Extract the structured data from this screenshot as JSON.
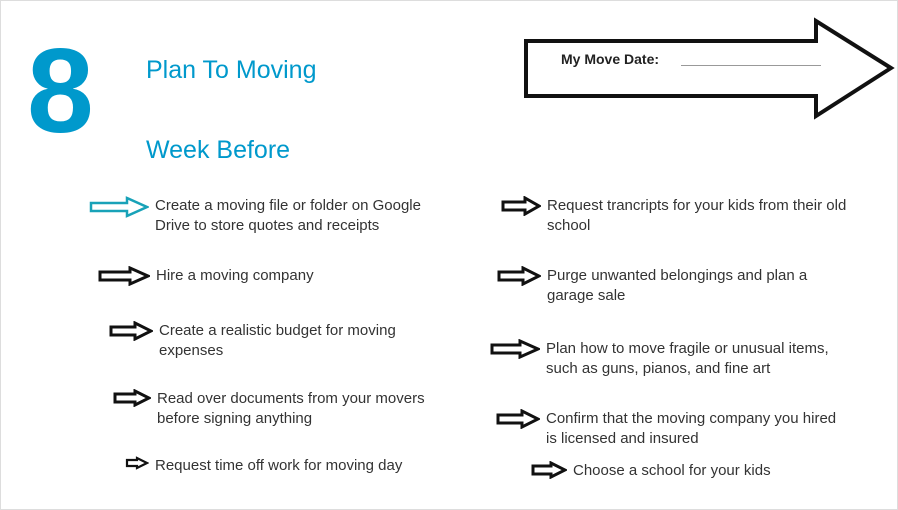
{
  "header": {
    "number": "8",
    "title_line1": "Plan To Moving",
    "title_line2": "Week Before",
    "move_date_label": "My Move Date:"
  },
  "left_items": [
    "Create a moving file or folder on Google Drive to store quotes and receipts",
    "Hire a moving company",
    "Create a realistic budget for moving expenses",
    "Read over documents from your movers before signing anything",
    "Request time off work for moving day"
  ],
  "right_items": [
    "Request trancripts for your kids from their old school",
    "Purge unwanted belongings and plan a garage sale",
    "Plan how to move fragile or unusual items, such as guns, pianos, and fine art",
    "Confirm that the moving company you hired is licensed and insured",
    "Choose a school for your kids"
  ]
}
